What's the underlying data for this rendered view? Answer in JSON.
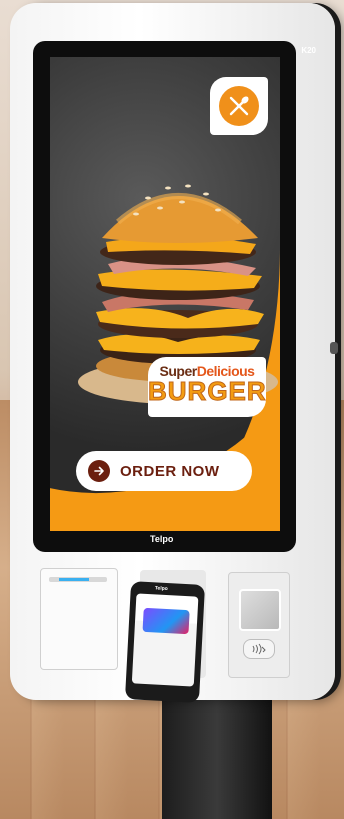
{
  "kiosk": {
    "model": "K20",
    "brand": "Telpo"
  },
  "screen": {
    "logo_icon": "fork-knife-icon",
    "tagline_top_a": "Super",
    "tagline_top_b": "Delicious",
    "tagline_main": "BURGER",
    "order_button_label": "ORDER NOW",
    "order_icon": "arrow-right-icon",
    "accent_color": "#f59a14",
    "button_text_color": "#6b1f0f"
  },
  "pos_terminal": {
    "brand": "Telpo"
  }
}
